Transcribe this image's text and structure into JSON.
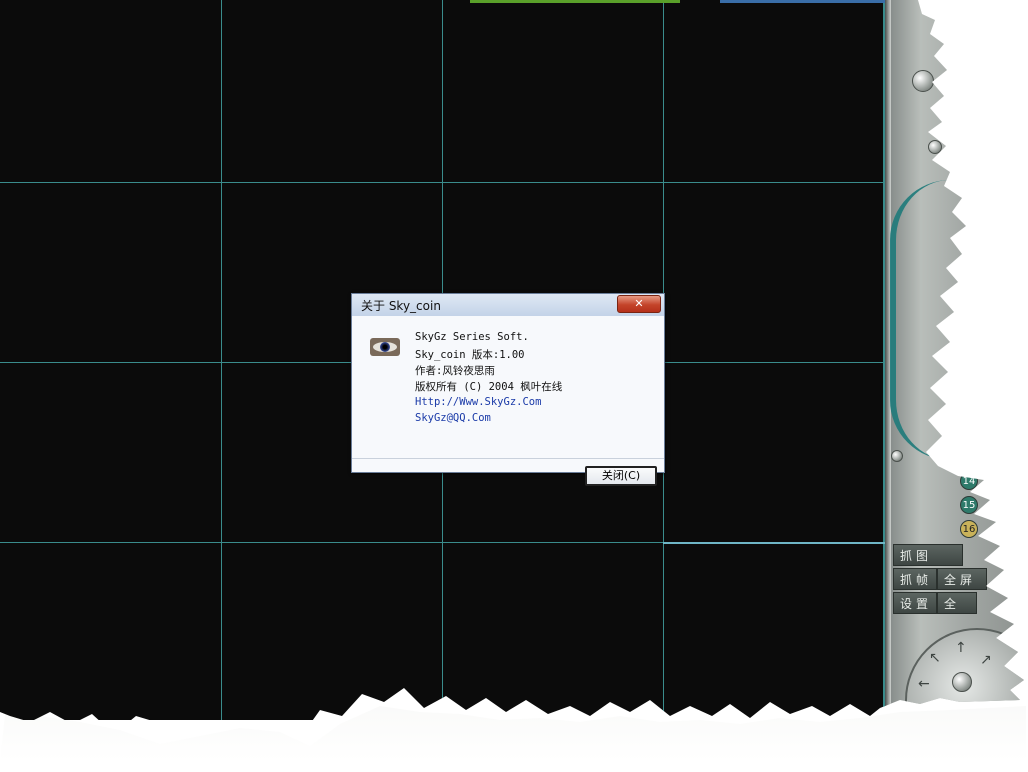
{
  "dialog": {
    "title": "关于 Sky_coin",
    "close_glyph": "✕",
    "icon": "eye-icon",
    "lines": {
      "company": "SkyGz Series Soft.",
      "version": "Sky_coin 版本:1.00",
      "author": "作者:风铃夜思雨",
      "copyright": "版权所有 (C) 2004 枫叶在线",
      "url": "Http://Www.SkyGz.Com",
      "email": "SkyGz@QQ.Com"
    },
    "close_button_label": "关闭(C)"
  },
  "side_panel": {
    "channels": [
      "14",
      "15",
      "16"
    ],
    "buttons": [
      "抓图",
      "抓帧",
      "全屏",
      "设置",
      "全"
    ],
    "arrows": [
      "↖",
      "↑",
      "↗",
      "←"
    ]
  },
  "colors": {
    "video_bg": "#0b0b0b",
    "grid_line": "#3a8c8c",
    "dialog_bg": "#f7f9fc",
    "titlebar": "#c3d3e8",
    "close_red": "#c4442a",
    "link": "#1a3aa8"
  }
}
